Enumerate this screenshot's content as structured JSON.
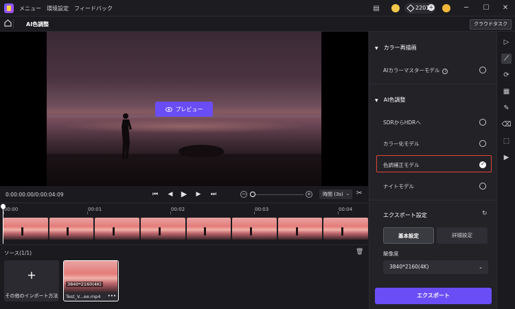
{
  "titlebar": {
    "menus": [
      "メニュー",
      "環境設定",
      "フィードバック"
    ],
    "credits": "2201",
    "window_controls": [
      "─",
      "☐",
      "✕"
    ]
  },
  "subbar": {
    "page_title": "AI色調整",
    "cloud_task": "クラウドタスク"
  },
  "preview": {
    "button_label": "プレビュー"
  },
  "playback": {
    "timecode": "0:00:00:00/0:00:04:09",
    "time_select": "時間 (3s)"
  },
  "timeline": {
    "ticks": [
      "00:00",
      "00:01",
      "00:02",
      "00:03",
      "00:04"
    ]
  },
  "source": {
    "title": "ソース(1/1)",
    "import_label": "その他のインポート方法",
    "clip_resolution": "3840*2160(4K)",
    "clip_name": "Test_V...ee.mp4"
  },
  "panel": {
    "color_repaint": {
      "title": "カラー再描画",
      "options": [
        "AIカラーマスターモデル"
      ]
    },
    "ai_color": {
      "title": "AI色調整",
      "options": [
        "SDRからHDRへ",
        "カラー化モデル",
        "色調補正モデル",
        "ナイトモデル"
      ],
      "selected": "色調補正モデル"
    },
    "export": {
      "title": "エクスポート設定",
      "tab_basic": "基本設定",
      "tab_detail": "詳細設定",
      "resolution_label": "解像度",
      "resolution_value": "3840*2160(4K)",
      "export_button": "エクスポート"
    }
  },
  "colors": {
    "accent": "#6a4df5",
    "selection_border": "#e0453a",
    "background": "#1b1b1f"
  }
}
